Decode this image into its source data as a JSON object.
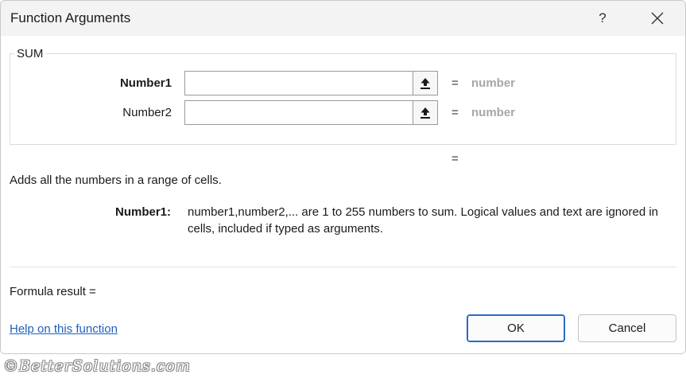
{
  "window": {
    "title": "Function Arguments",
    "help_glyph": "?",
    "close_icon": "close-icon"
  },
  "function_group": {
    "name": "SUM",
    "arguments": [
      {
        "label": "Number1",
        "value": "",
        "equals": "=",
        "result": "number",
        "bold": true
      },
      {
        "label": "Number2",
        "value": "",
        "equals": "=",
        "result": "number",
        "bold": false
      }
    ],
    "ref_button_icon": "collapse-dialog-arrow-icon"
  },
  "result_equals": "=",
  "description": "Adds all the numbers in a range of cells.",
  "argument_help": {
    "label": "Number1:",
    "text": "number1,number2,... are 1 to 255 numbers to sum. Logical values and text are ignored in cells, included if typed as arguments."
  },
  "formula_result": "Formula result =",
  "help_link": "Help on this function",
  "buttons": {
    "ok": "OK",
    "cancel": "Cancel"
  },
  "watermark": "©BetterSolutions.com",
  "colors": {
    "accent": "#2a6ac7",
    "link": "#1f5fbf",
    "muted_value": "#a6a6a6",
    "titlebar": "#f3f3f3"
  }
}
